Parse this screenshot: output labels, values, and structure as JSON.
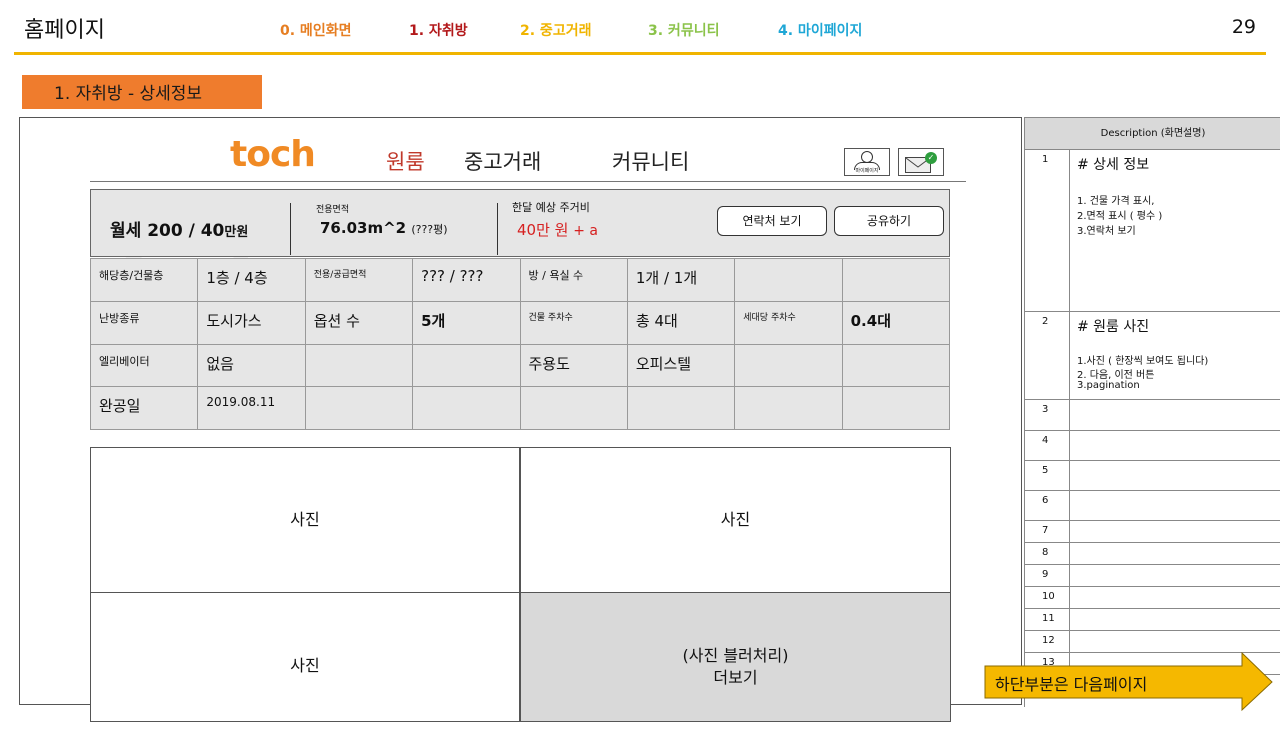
{
  "slide": {
    "title": "홈페이지",
    "page_number": "29",
    "nav": [
      {
        "label": "0. 메인화면",
        "color": "#e67e22"
      },
      {
        "label": "1. 자취방",
        "color": "#b3191b"
      },
      {
        "label": "2. 중고거래",
        "color": "#f0b400"
      },
      {
        "label": "3. 커뮤니티",
        "color": "#8bc34a"
      },
      {
        "label": "4. 마이페이지",
        "color": "#1fa7d6"
      }
    ],
    "section_tag": "1. 자취방 - 상세정보",
    "section_tag_color": "#ef7c2d"
  },
  "mockup": {
    "logo": "toch",
    "nav": {
      "oneroom": "원룸",
      "used": "중고거래",
      "community": "커뮤니티"
    },
    "mypage_label": "마이페이지",
    "summary": {
      "price_main": "월세 200 / 40",
      "price_unit": "만원",
      "area_label": "전용면적",
      "area_value": "76.03m^2",
      "area_sub": "(???평)",
      "cost_label": "한달 예상 주거비",
      "cost_value": "40만 원",
      "cost_plus": "+ a",
      "contact_button": "연락처 보기",
      "share_button": "공유하기"
    },
    "details": {
      "floor_label": "해당층/건물층",
      "floor_value": "1층 / 4층",
      "area_label": "전용/공급면적",
      "area_value": "??? / ???",
      "rooms_label": "방 / 욕실 수",
      "rooms_value": "1개 / 1개",
      "heating_label": "난방종류",
      "heating_value": "도시가스",
      "options_label": "옵션 수",
      "options_value": "5개",
      "parking_label": "건물 주차수",
      "parking_value": "총 4대",
      "household_parking_label": "세대당 주차수",
      "household_parking_value": "0.4대",
      "elevator_label": "엘리베이터",
      "elevator_value": "없음",
      "usage_label": "주용도",
      "usage_value": "오피스텔",
      "completion_label": "완공일",
      "completion_value": "2019.08.11"
    },
    "photos": {
      "photo": "사진",
      "more_line1": "(사진 블러처리)",
      "more_line2": "더보기"
    }
  },
  "description": {
    "header": "Description (화면설명)",
    "rows": [
      {
        "num": "1",
        "title": "# 상세 정보",
        "lines": [
          "1. 건물 가격 표시,",
          "2.면적 표시 ( 평수 )",
          "3.연락처 보기"
        ]
      },
      {
        "num": "2",
        "title": "# 원룸 사진",
        "lines": [
          "1.사진 ( 한장씩 보여도 됩니다)",
          "2. 다음, 이전 버튼",
          "3.pagination"
        ]
      },
      {
        "num": "3"
      },
      {
        "num": "4"
      },
      {
        "num": "5"
      },
      {
        "num": "6"
      },
      {
        "num": "7"
      },
      {
        "num": "8"
      },
      {
        "num": "9"
      },
      {
        "num": "10"
      },
      {
        "num": "11"
      },
      {
        "num": "12"
      },
      {
        "num": "13"
      }
    ]
  },
  "next_page": "하단부분은 다음페이지",
  "next_page_color": "#f5b800"
}
